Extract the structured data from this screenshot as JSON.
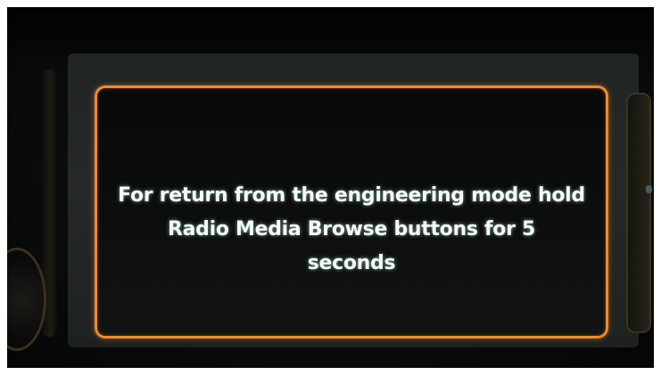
{
  "dialog": {
    "message_lines": [
      "For return from the engineering mode hold",
      "Radio Media Browse buttons for 5",
      "seconds"
    ]
  },
  "colors": {
    "dialog_border": "#f08a2a",
    "message_text": "#f4fbf8",
    "screen_background": "#0a0c0b"
  }
}
